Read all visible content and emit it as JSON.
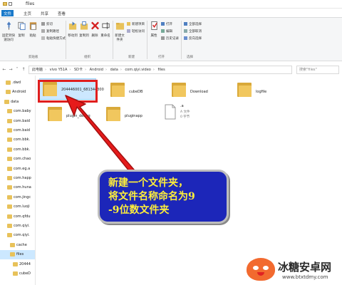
{
  "window": {
    "title": "files"
  },
  "ribbon_tabs": [
    "文件",
    "主页",
    "共享",
    "查看"
  ],
  "ribbon": {
    "buttons": [
      {
        "label": "固定到快速访问",
        "icon": "pin-icon"
      },
      {
        "label": "复制",
        "icon": "copy-icon"
      },
      {
        "label": "粘贴",
        "icon": "paste-icon"
      },
      {
        "label": "移动到",
        "icon": "move-to-icon"
      },
      {
        "label": "复制到",
        "icon": "copy-to-icon"
      },
      {
        "label": "删除",
        "icon": "delete-icon"
      },
      {
        "label": "重命名",
        "icon": "rename-icon"
      },
      {
        "label": "新建文件夹",
        "icon": "new-folder-icon"
      },
      {
        "label": "属性",
        "icon": "properties-icon"
      }
    ],
    "small_items": {
      "clipboard": [
        "剪切",
        "复制路径",
        "粘贴快捷方式"
      ],
      "new": [
        "新建项目",
        "轻松访问"
      ],
      "open": [
        "打开",
        "编辑",
        "历史记录"
      ],
      "select": [
        "全部选择",
        "全部取消",
        "反向选择"
      ]
    },
    "groups": [
      "剪贴板",
      "组织",
      "新建",
      "打开",
      "选择"
    ]
  },
  "address": {
    "crumbs": [
      "此电脑",
      "vivo Y51A",
      "SD卡",
      "Android",
      "data",
      "com.qiyi.video",
      "files"
    ],
    "search_placeholder": "搜索\"files\""
  },
  "nav_pane": [
    {
      "label": ".dwd",
      "indent": 1
    },
    {
      "label": "Android",
      "indent": 1
    },
    {
      "label": "data",
      "indent": 2
    },
    {
      "label": "com.baby",
      "indent": 3
    },
    {
      "label": "com.baid",
      "indent": 3
    },
    {
      "label": "com.baid",
      "indent": 3
    },
    {
      "label": "com.bbk.",
      "indent": 3
    },
    {
      "label": "com.bbk.",
      "indent": 3
    },
    {
      "label": "com.chao",
      "indent": 3
    },
    {
      "label": "com.eg.a",
      "indent": 3
    },
    {
      "label": "com.happ",
      "indent": 3
    },
    {
      "label": "com.huna",
      "indent": 3
    },
    {
      "label": "com.jingc",
      "indent": 3
    },
    {
      "label": "com.luoji",
      "indent": 3
    },
    {
      "label": "com.qfdu",
      "indent": 3
    },
    {
      "label": "com.qiyi.",
      "indent": 3
    },
    {
      "label": "com.qiyi.",
      "indent": 3
    },
    {
      "label": "cache",
      "indent": 4
    },
    {
      "label": "files",
      "indent": 4,
      "selected": true
    },
    {
      "label": "20444",
      "indent": 5
    },
    {
      "label": "cubeD",
      "indent": 5
    }
  ],
  "files": [
    {
      "name": "204446001_681344300",
      "type": "folder",
      "selected": true
    },
    {
      "name": "cubeDB",
      "type": "folder"
    },
    {
      "name": "Download",
      "type": "folder"
    },
    {
      "name": "logfile",
      "type": "folder"
    },
    {
      "name": "plugin_debug",
      "type": "folder"
    },
    {
      "name": "pluginapp",
      "type": "folder"
    },
    {
      "name": ".a",
      "type": "file",
      "meta1": "A 文件",
      "meta2": "0 字节"
    }
  ],
  "callout": {
    "text": "新建一个文件夹，\n将文件名称命名为9\n-9位数文件夹"
  },
  "watermark": {
    "title": "冰糖安卓网",
    "url": "www.btxtdmy.com"
  },
  "colors": {
    "highlight": "#e01e1e",
    "callout_bg": "#1c26b9",
    "callout_text": "#ffef3a",
    "selection": "#cce8ff"
  }
}
